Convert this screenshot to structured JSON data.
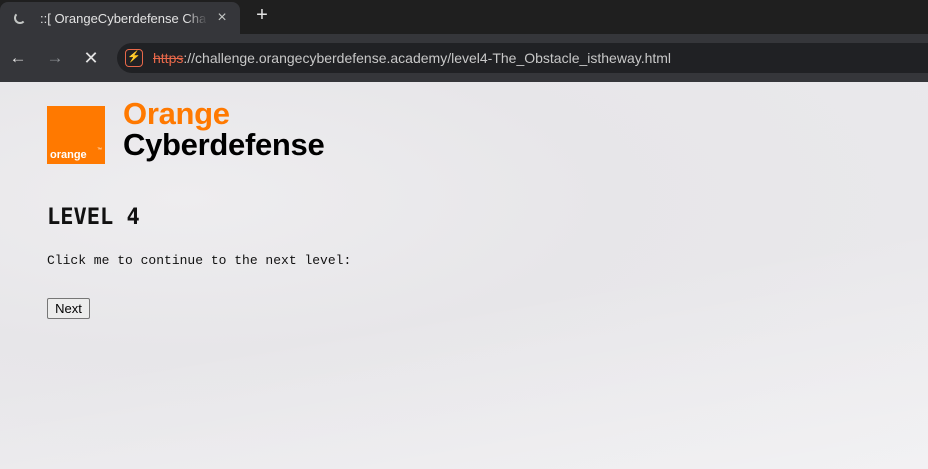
{
  "browser": {
    "tab": {
      "title": "::[ OrangeCyberdefense Challenge ]::",
      "close_icon": "×"
    },
    "new_tab_icon": "+",
    "nav": {
      "back_icon": "←",
      "forward_icon": "→",
      "stop_icon": "✕"
    },
    "address": {
      "scheme": "https",
      "rest": "://challenge.orangecyberdefense.academy/level4-The_Obstacle_istheway.html",
      "site_icon": "⚡"
    }
  },
  "page": {
    "logo": {
      "square_text": "orange",
      "square_tm": "™",
      "line1": "Orange",
      "line2": "Cyberdefense",
      "brand_color": "#ff7900"
    },
    "heading": "LEVEL 4",
    "instruction": "Click me to continue to the next level:",
    "next_button": "Next"
  }
}
